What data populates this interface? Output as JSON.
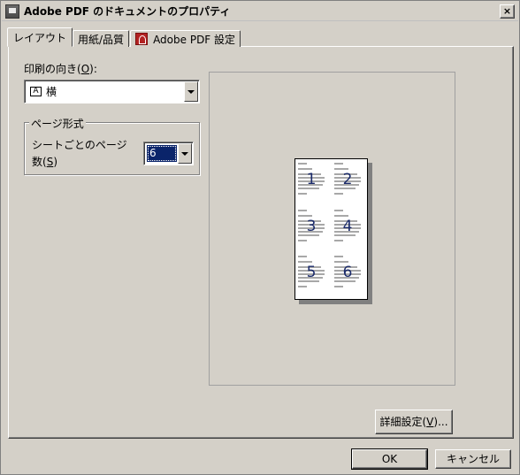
{
  "window": {
    "title": "Adobe PDF のドキュメントのプロパティ",
    "close_label": "×"
  },
  "tabs": [
    {
      "label": "レイアウト",
      "active": true
    },
    {
      "label": "用紙/品質",
      "active": false
    },
    {
      "label": "Adobe PDF 設定",
      "active": false,
      "icon": "adobe-pdf-icon"
    }
  ],
  "layout": {
    "orientation_label_prefix": "印刷の向き(",
    "orientation_label_key": "O",
    "orientation_label_suffix": "):",
    "orientation_value": "横",
    "orientation_icon_glyph": "A",
    "page_format_legend": "ページ形式",
    "pages_per_sheet_label_prefix": "シートごとのページ数(",
    "pages_per_sheet_label_key": "S",
    "pages_per_sheet_label_suffix": ")",
    "pages_per_sheet_value": "6"
  },
  "preview": {
    "page_numbers": [
      "1",
      "2",
      "3",
      "4",
      "5",
      "6"
    ]
  },
  "buttons": {
    "advanced_prefix": "詳細設定(",
    "advanced_key": "V",
    "advanced_suffix": ")...",
    "ok": "OK",
    "cancel": "キャンセル"
  }
}
